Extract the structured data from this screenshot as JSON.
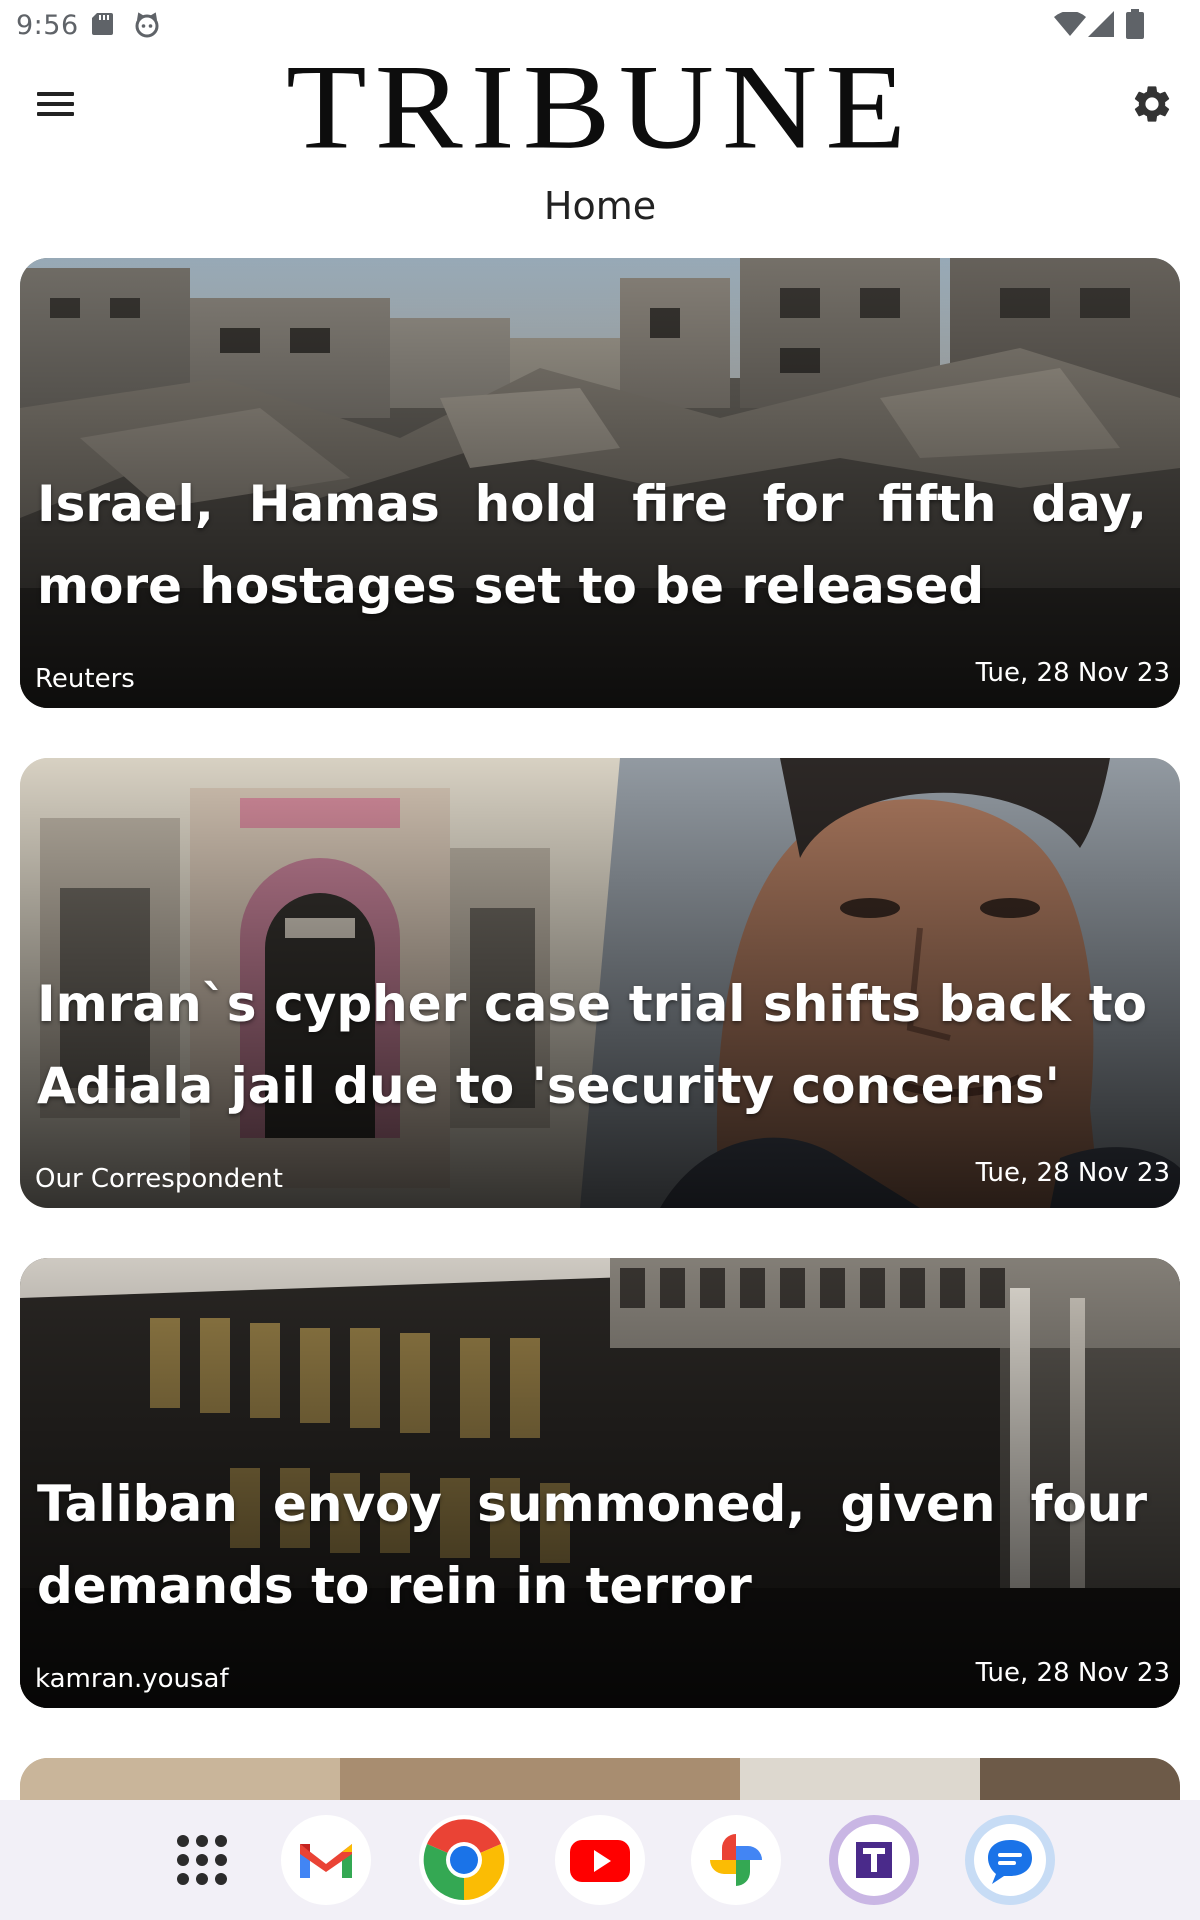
{
  "status_bar": {
    "time": "9:56",
    "icons": [
      "sd-card-icon",
      "cat-icon",
      "wifi-icon",
      "cell-signal-icon",
      "battery-icon"
    ]
  },
  "header": {
    "logo": "TRIBUNE",
    "page_title": "Home",
    "menu_icon": "hamburger-menu-icon",
    "settings_icon": "gear-icon"
  },
  "articles": [
    {
      "headline": "Israel, Hamas hold fire for fifth day, more hostages set to be released",
      "source": "Reuters",
      "date": "Tue, 28 Nov 23",
      "image": "gaza-rubble-photo"
    },
    {
      "headline": "Imran`s cypher case trial shifts back to Adiala jail due to 'security concerns'",
      "source": "Our Correspondent",
      "date": "Tue, 28 Nov 23",
      "image": "imran-khan-jail-photo"
    },
    {
      "headline": "Taliban envoy summoned, given four demands to rein in terror",
      "source": "kamran.yousaf",
      "date": "Tue, 28 Nov 23",
      "image": "ministry-of-foreign-affairs-photo"
    },
    {
      "headline": "",
      "source": "",
      "date": "",
      "image": "partial-article-photo"
    }
  ],
  "dock": {
    "apps": [
      "app-drawer-icon",
      "gmail-icon",
      "chrome-icon",
      "youtube-icon",
      "google-photos-icon",
      "tribune-app-icon",
      "messages-icon"
    ]
  },
  "colors": {
    "background": "#ffffff",
    "dock_background": "#f2f0f7",
    "text_dark": "#0d0d0d",
    "headline_text": "#ffffff"
  }
}
